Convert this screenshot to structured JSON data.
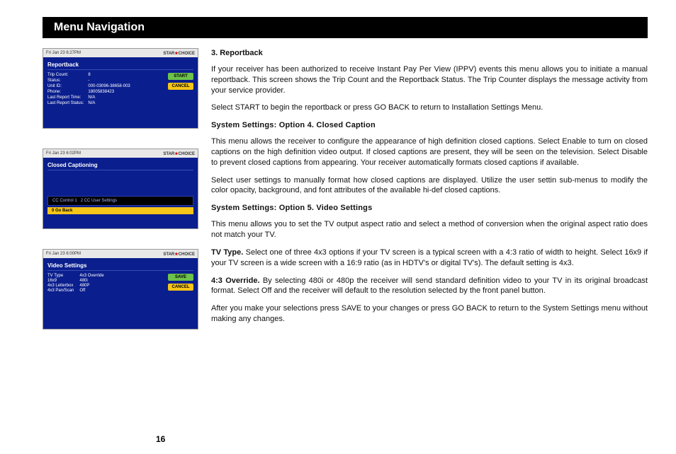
{
  "header": "Menu Navigation",
  "page_number": "16",
  "screenshots": {
    "timestamp1": "Fri Jan 23 6:27PM",
    "timestamp2": "Fri Jan 23 6:02PM",
    "timestamp3": "Fri Jan 23 6:00PM",
    "brand_a": "STAR",
    "brand_b": "CHOICE",
    "report": {
      "title": "Reportback",
      "labels": [
        "Trip Count:",
        "Status:",
        "Unit ID:",
        "Phone:",
        "Last Report Time:",
        "Last Report Status:"
      ],
      "values": [
        "8",
        "-",
        "000-03096-38658-003",
        "18005838423",
        "N/A",
        "N/A"
      ],
      "btn_start": "START",
      "btn_cancel": "CANCEL"
    },
    "cc": {
      "title": "Closed Captioning",
      "row1a": "CC Control 1",
      "row1b": "2 CC User Settings",
      "row2": "0 Go Back"
    },
    "video": {
      "title": "Video Settings",
      "col1": [
        "TV Type",
        "16x9",
        "4x3 Letterbox",
        "4x3 Pan/Scan"
      ],
      "col2": [
        "4x3 Override",
        "480i",
        "480P",
        "Off"
      ],
      "btn_save": "SAVE",
      "btn_cancel": "CANCEL"
    }
  },
  "text": {
    "s3_title": "3. Reportback",
    "s3_p1": "If your receiver has been authorized to receive Instant Pay Per View (IPPV) events this menu allows you to initiate a manual reportback. This screen shows the Trip Count and the Reportback Status. The Trip Counter displays the message activity from your service provider.",
    "s3_p2": "Select START to begin the reportback or press GO BACK to return to Installation Settings Menu.",
    "s4_title": "System Settings: Option 4. Closed Caption",
    "s4_p1": "This menu allows the receiver to configure the appearance of high definition closed captions. Select Enable to turn on closed captions on the high definition video output. If closed captions are present, they will be seen on the television. Select Disable to prevent closed captions from appearing. Your receiver automatically formats closed captions if available.",
    "s4_p2": "Select user settings to manually format how closed captions are displayed. Utilize the user settin sub-menus to modify the color opacity, background, and font attributes of the available hi-def closed captions.",
    "s5_title": "System Settings: Option 5. Video Settings",
    "s5_p1": "This menu allows you to set the TV output aspect ratio and select a method of conversion when the original aspect ratio does not match your TV.",
    "s5_tv_lead": "TV Type.",
    "s5_tv_body": " Select one of three 4x3 options if your TV screen is a typical screen with a 4:3 ratio of width to height. Select 16x9 if your TV screen is a wide screen with a 16:9 ratio (as in HDTV's or digital TV's). The default setting is 4x3.",
    "s5_ov_lead": "4:3 Override.",
    "s5_ov_body": " By selecting 480i or 480p the receiver will send standard definition video to your TV in its original broadcast format. Select Off and the receiver will default to the resolution selected by the front panel button.",
    "s5_p4": "After you make your selections press SAVE to your changes or press GO BACK to return to the System Settings menu without making any changes."
  }
}
